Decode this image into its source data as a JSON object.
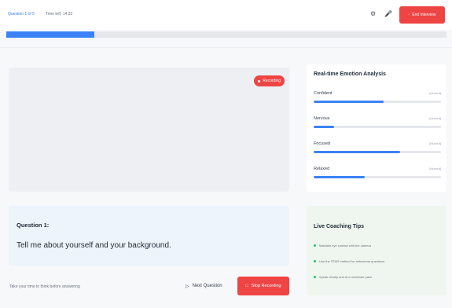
{
  "header": {
    "question_counter": "Question 1 of 5",
    "timer": "Time left: 14:32",
    "settings_icon": "settings-icon",
    "mic_icon": "mic-icon",
    "end_button": "End Interview",
    "progress_fraction": 0.2
  },
  "video": {
    "recording_badge": "Recording"
  },
  "question": {
    "title": "Question 1:",
    "text": "Tell me about yourself and your background."
  },
  "footer": {
    "hint": "Take your time to think before answering",
    "next_label": "Next Question",
    "stop_label": "Stop Recording"
  },
  "emotion": {
    "title": "Real-time Emotion Analysis",
    "items": [
      {
        "name": "Confident",
        "value": "[blurred]",
        "level": 0.55
      },
      {
        "name": "Nervous",
        "value": "[blurred]",
        "level": 0.16
      },
      {
        "name": "Focused",
        "value": "[blurred]",
        "level": 0.68
      },
      {
        "name": "Relaxed",
        "value": "[blurred]",
        "level": 0.4
      }
    ]
  },
  "tips": {
    "title": "Live Coaching Tips",
    "items": [
      "Maintain eye contact with the camera",
      "Use the STAR method for behavioral questions",
      "Speak clearly and at a moderate pace"
    ]
  },
  "colors": {
    "accent": "#3b82f6",
    "danger": "#ef4444",
    "success": "#22c55e"
  }
}
